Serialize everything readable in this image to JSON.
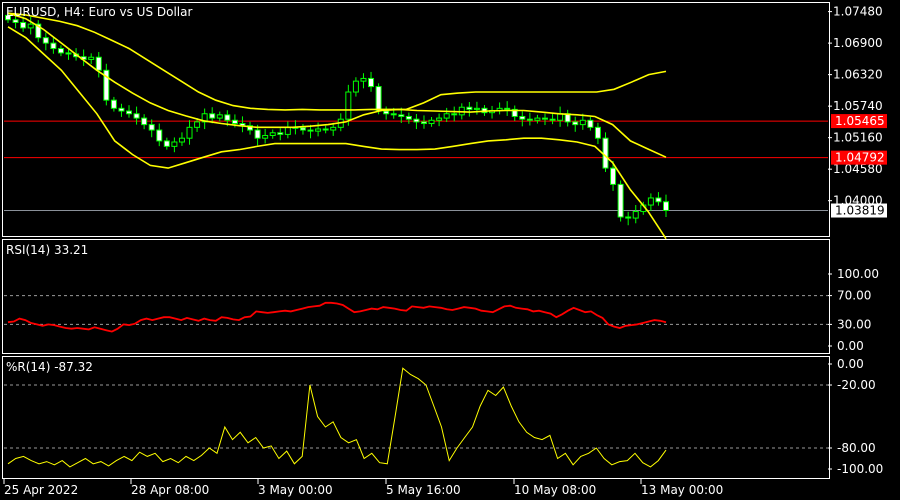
{
  "chart_data": [
    {
      "type": "line",
      "title": "EURUSD, H4:  Euro vs US Dollar",
      "symbol": "EURUSD",
      "timeframe": "H4",
      "description": "Euro vs US Dollar",
      "ylim": [
        1.0335,
        1.0762
      ],
      "y_ticks": [
        "1.07480",
        "1.06900",
        "1.06320",
        "1.05740",
        "1.05160",
        "1.04580",
        "1.04000"
      ],
      "x_ticks": [
        "25 Apr 2022",
        "28 Apr 08:00",
        "3 May 00:00",
        "5 May 16:00",
        "10 May 08:00",
        "13 May 00:00"
      ],
      "horizontal_lines": [
        {
          "label": "1.05465",
          "value": 1.05465,
          "color": "#ff0000"
        },
        {
          "label": "1.04792",
          "value": 1.04792,
          "color": "#ff0000"
        }
      ],
      "bid_line": {
        "label": "1.03819",
        "value": 1.03819,
        "color": "#8a9099"
      },
      "candle_color": "#00ff00",
      "closes": [
        1.0733,
        1.0728,
        1.0718,
        1.0725,
        1.07,
        1.069,
        1.068,
        1.0672,
        1.067,
        1.0665,
        1.066,
        1.0664,
        1.064,
        1.0585,
        1.057,
        1.0565,
        1.056,
        1.0552,
        1.054,
        1.053,
        1.051,
        1.05,
        1.0508,
        1.0515,
        1.0535,
        1.0545,
        1.056,
        1.0552,
        1.0558,
        1.0548,
        1.0542,
        1.0538,
        1.053,
        1.0515,
        1.052,
        1.0525,
        1.0522,
        1.0535,
        1.0534,
        1.053,
        1.0528,
        1.0532,
        1.053,
        1.0535,
        1.055,
        1.06,
        1.062,
        1.0625,
        1.061,
        1.0565,
        1.056,
        1.0558,
        1.0555,
        1.055,
        1.0545,
        1.0542,
        1.0548,
        1.0552,
        1.056,
        1.0558,
        1.0572,
        1.0568,
        1.057,
        1.0562,
        1.0566,
        1.057,
        1.0568,
        1.0555,
        1.055,
        1.0548,
        1.0552,
        1.055,
        1.0548,
        1.056,
        1.0545,
        1.054,
        1.0548,
        1.0535,
        1.0515,
        1.046,
        1.043,
        1.037,
        1.0368,
        1.038,
        1.0392,
        1.0405,
        1.0398,
        1.0382
      ],
      "bands": {
        "color": "#ffff00",
        "upper": [
          1.0745,
          1.0742,
          1.0736,
          1.073,
          1.0722,
          1.071,
          1.0695,
          1.068,
          1.066,
          1.064,
          1.062,
          1.06,
          1.0585,
          1.0575,
          1.057,
          1.0568,
          1.0567,
          1.0568,
          1.0567,
          1.0567,
          1.0567,
          1.0568,
          1.0568,
          1.0568,
          1.058,
          1.0595,
          1.0598,
          1.06,
          1.06,
          1.06,
          1.06,
          1.06,
          1.06,
          1.06,
          1.06,
          1.0605,
          1.0618,
          1.0632,
          1.0638
        ],
        "middle": [
          1.0745,
          1.0735,
          1.0715,
          1.069,
          1.0665,
          1.064,
          1.0618,
          1.0598,
          1.058,
          1.0566,
          1.0556,
          1.0547,
          1.0542,
          1.0538,
          1.0535,
          1.0535,
          1.0535,
          1.0537,
          1.054,
          1.0545,
          1.0558,
          1.0566,
          1.0568,
          1.0566,
          1.0565,
          1.0564,
          1.0563,
          1.0565,
          1.0566,
          1.0566,
          1.0563,
          1.056,
          1.0558,
          1.0555,
          1.054,
          1.051,
          1.0495,
          1.048
        ],
        "lower": [
          1.072,
          1.07,
          1.067,
          1.064,
          1.06,
          1.056,
          1.051,
          1.0485,
          1.0465,
          1.046,
          1.047,
          1.048,
          1.049,
          1.0494,
          1.05,
          1.0505,
          1.0505,
          1.0505,
          1.0505,
          1.0505,
          1.05,
          1.0495,
          1.0494,
          1.0494,
          1.0495,
          1.05,
          1.0505,
          1.051,
          1.0512,
          1.0515,
          1.0515,
          1.0512,
          1.0508,
          1.05,
          1.047,
          1.042,
          1.038,
          1.033
        ]
      }
    },
    {
      "type": "line",
      "title": "RSI(14) 33.21",
      "series_color": "#ff0000",
      "ylim": [
        0,
        100
      ],
      "y_ticks": [
        "100.00",
        "70.00",
        "30.00",
        "0.00"
      ],
      "levels": [
        70,
        30
      ],
      "values": [
        33,
        34,
        38,
        36,
        32,
        30,
        28,
        30,
        29,
        27,
        25,
        24,
        25,
        24,
        23,
        26,
        24,
        22,
        20,
        24,
        30,
        29,
        31,
        36,
        38,
        36,
        38,
        40,
        40,
        38,
        36,
        39,
        37,
        35,
        38,
        36,
        35,
        40,
        39,
        37,
        36,
        40,
        41,
        48,
        47,
        46,
        47,
        48,
        49,
        48,
        50,
        52,
        54,
        55,
        56,
        60,
        60,
        59,
        57,
        52,
        47,
        48,
        50,
        52,
        51,
        54,
        53,
        52,
        50,
        49,
        55,
        54,
        53,
        55,
        54,
        53,
        51,
        50,
        52,
        54,
        53,
        52,
        49,
        48,
        47,
        51,
        55,
        56,
        53,
        52,
        51,
        48,
        49,
        47,
        45,
        40,
        44,
        49,
        53,
        50,
        47,
        48,
        43,
        39,
        30,
        27,
        25,
        28,
        29,
        30,
        32,
        34,
        36,
        35,
        33
      ]
    },
    {
      "type": "line",
      "title": "%R(14) -87.32",
      "series_color": "#ffff00",
      "ylim": [
        -100,
        0
      ],
      "y_ticks": [
        "0.00",
        "-20.00",
        "-80.00",
        "-100.00"
      ],
      "levels": [
        -20,
        -80
      ],
      "values": [
        -95,
        -90,
        -88,
        -92,
        -95,
        -93,
        -96,
        -92,
        -98,
        -94,
        -90,
        -95,
        -93,
        -97,
        -92,
        -88,
        -92,
        -84,
        -88,
        -85,
        -93,
        -90,
        -94,
        -88,
        -92,
        -87,
        -80,
        -85,
        -60,
        -72,
        -65,
        -75,
        -70,
        -80,
        -78,
        -90,
        -83,
        -95,
        -88,
        -20,
        -50,
        -60,
        -55,
        -70,
        -75,
        -72,
        -90,
        -85,
        -94,
        -95,
        -50,
        -4,
        -10,
        -14,
        -20,
        -40,
        -60,
        -92,
        -80,
        -70,
        -60,
        -40,
        -25,
        -30,
        -22,
        -40,
        -55,
        -65,
        -70,
        -72,
        -68,
        -90,
        -85,
        -96,
        -88,
        -85,
        -80,
        -90,
        -96,
        -93,
        -92,
        -85,
        -94,
        -98,
        -92,
        -82
      ]
    }
  ]
}
